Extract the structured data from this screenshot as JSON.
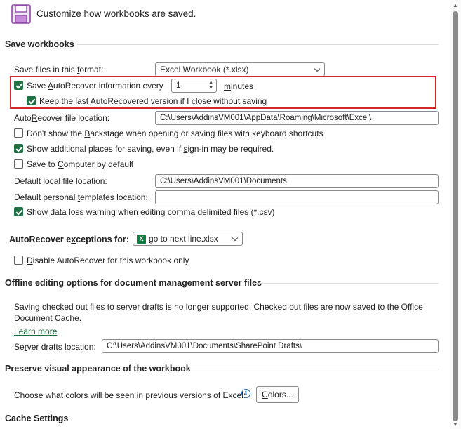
{
  "header": {
    "title": "Customize how workbooks are saved."
  },
  "save_workbooks": {
    "title": "Save workbooks",
    "format_label_pre": "Save files in this ",
    "format_label_key": "f",
    "format_label_post": "ormat:",
    "format_value": "Excel Workbook (*.xlsx)",
    "autorecover_pre": "Save ",
    "autorecover_key": "A",
    "autorecover_post": "utoRecover information every",
    "autorecover_checked": true,
    "minutes_value": "1",
    "minutes_key": "m",
    "minutes_rest": "inutes",
    "keep_pre": "Keep the last ",
    "keep_key": "A",
    "keep_post": "utoRecovered version if I close without saving",
    "keep_checked": true,
    "ar_location_pre": "Auto",
    "ar_location_key": "R",
    "ar_location_post": "ecover file location:",
    "ar_location_value": "C:\\Users\\AddinsVM001\\AppData\\Roaming\\Microsoft\\Excel\\",
    "backstage_pre": "Don't show the ",
    "backstage_key": "B",
    "backstage_post": "ackstage when opening or saving files with keyboard shortcuts",
    "backstage_checked": false,
    "additional_pre": "Show additional places for saving, even if ",
    "additional_key": "s",
    "additional_post": "ign-in may be required.",
    "additional_checked": true,
    "computer_pre": "Save to ",
    "computer_key": "C",
    "computer_post": "omputer by default",
    "computer_checked": false,
    "local_pre": "Default local ",
    "local_key": "f",
    "local_post": "ile location:",
    "local_value": "C:\\Users\\AddinsVM001\\Documents",
    "templates_pre": "Default personal ",
    "templates_key": "t",
    "templates_post": "emplates location:",
    "templates_value": "",
    "dataloss_label": "Show data loss warning when editing comma delimited files (*.csv)",
    "dataloss_checked": true
  },
  "exceptions": {
    "label_pre": "AutoRecover e",
    "label_key": "x",
    "label_post": "ceptions for:",
    "workbook_value": "go to next line.xlsx",
    "disable_key": "D",
    "disable_post": "isable AutoRecover for this workbook only",
    "disable_checked": false
  },
  "offline": {
    "title": "Offline editing options for document management server files",
    "notice_line1": "Saving checked out files to server drafts is no longer supported. Checked out files are now saved to the Office",
    "notice_line2": "Document Cache.",
    "learn_more": "Learn more",
    "drafts_pre": "Se",
    "drafts_key": "r",
    "drafts_post": "ver drafts location:",
    "drafts_value": "C:\\Users\\AddinsVM001\\Documents\\SharePoint Drafts\\"
  },
  "preserve": {
    "title": "Preserve visual appearance of the workbook",
    "colors_label": "Choose what colors will be seen in previous versions of Excel:",
    "colors_button_key": "C",
    "colors_button_post": "olors..."
  },
  "cache": {
    "title": "Cache Settings"
  },
  "colors": {
    "accent": "#217346",
    "highlight_border": "#d4262c"
  }
}
